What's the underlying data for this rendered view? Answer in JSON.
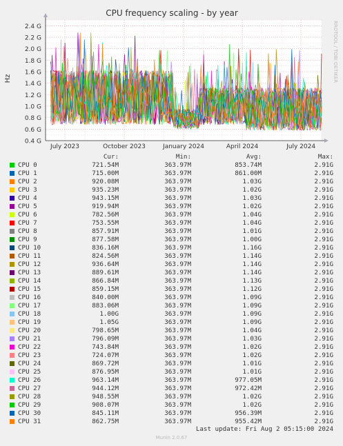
{
  "chart_data": {
    "type": "line",
    "title": "CPU frequency scaling - by year",
    "ylabel": "Hz",
    "side_label": "RRDTOOL / TOBI OETIKER",
    "ylim": [
      0.4,
      2.5
    ],
    "yticks": [
      {
        "v": 0.4,
        "label": "0.4 G"
      },
      {
        "v": 0.6,
        "label": "0.6 G"
      },
      {
        "v": 0.8,
        "label": "0.8 G"
      },
      {
        "v": 1.0,
        "label": "1.0 G"
      },
      {
        "v": 1.2,
        "label": "1.2 G"
      },
      {
        "v": 1.4,
        "label": "1.4 G"
      },
      {
        "v": 1.6,
        "label": "1.6 G"
      },
      {
        "v": 1.8,
        "label": "1.8 G"
      },
      {
        "v": 2.0,
        "label": "2.0 G"
      },
      {
        "v": 2.2,
        "label": "2.2 G"
      },
      {
        "v": 2.4,
        "label": "2.4 G"
      }
    ],
    "xlim": [
      "2023-06-01",
      "2024-08-02"
    ],
    "xticks": [
      {
        "date": "2023-07-01",
        "label": "July 2023"
      },
      {
        "date": "2023-10-01",
        "label": "October 2023"
      },
      {
        "date": "2024-01-01",
        "label": "January 2024"
      },
      {
        "date": "2024-04-01",
        "label": "April 2024"
      },
      {
        "date": "2024-07-01",
        "label": "July 2024"
      }
    ],
    "grid": true,
    "legend_headers": {
      "cur": "Cur:",
      "min": "Min:",
      "avg": "Avg:",
      "max": "Max:"
    },
    "series": [
      {
        "name": "CPU 0",
        "color": "#00cc00",
        "cur": "721.54M",
        "min": "363.97M",
        "avg": "853.74M",
        "max": "2.91G"
      },
      {
        "name": "CPU 1",
        "color": "#0066b3",
        "cur": "715.00M",
        "min": "363.97M",
        "avg": "861.00M",
        "max": "2.91G"
      },
      {
        "name": "CPU 2",
        "color": "#ff8000",
        "cur": "920.08M",
        "min": "363.97M",
        "avg": "1.03G",
        "max": "2.91G"
      },
      {
        "name": "CPU 3",
        "color": "#ffcc00",
        "cur": "935.23M",
        "min": "363.97M",
        "avg": "1.02G",
        "max": "2.91G"
      },
      {
        "name": "CPU 4",
        "color": "#330099",
        "cur": "943.15M",
        "min": "363.97M",
        "avg": "1.03G",
        "max": "2.91G"
      },
      {
        "name": "CPU 5",
        "color": "#990099",
        "cur": "919.94M",
        "min": "363.97M",
        "avg": "1.02G",
        "max": "2.91G"
      },
      {
        "name": "CPU 6",
        "color": "#ccff00",
        "cur": "782.56M",
        "min": "363.97M",
        "avg": "1.04G",
        "max": "2.91G"
      },
      {
        "name": "CPU 7",
        "color": "#ff0000",
        "cur": "753.55M",
        "min": "363.97M",
        "avg": "1.04G",
        "max": "2.91G"
      },
      {
        "name": "CPU 8",
        "color": "#808080",
        "cur": "857.91M",
        "min": "363.97M",
        "avg": "1.01G",
        "max": "2.91G"
      },
      {
        "name": "CPU 9",
        "color": "#008f00",
        "cur": "877.58M",
        "min": "363.97M",
        "avg": "1.00G",
        "max": "2.91G"
      },
      {
        "name": "CPU 10",
        "color": "#00487d",
        "cur": "836.16M",
        "min": "363.97M",
        "avg": "1.16G",
        "max": "2.91G"
      },
      {
        "name": "CPU 11",
        "color": "#b35a00",
        "cur": "824.56M",
        "min": "363.97M",
        "avg": "1.14G",
        "max": "2.91G"
      },
      {
        "name": "CPU 12",
        "color": "#b38f00",
        "cur": "936.64M",
        "min": "363.97M",
        "avg": "1.14G",
        "max": "2.91G"
      },
      {
        "name": "CPU 13",
        "color": "#6b006b",
        "cur": "889.61M",
        "min": "363.97M",
        "avg": "1.14G",
        "max": "2.91G"
      },
      {
        "name": "CPU 14",
        "color": "#8fb300",
        "cur": "866.84M",
        "min": "363.97M",
        "avg": "1.13G",
        "max": "2.91G"
      },
      {
        "name": "CPU 15",
        "color": "#b30000",
        "cur": "859.15M",
        "min": "363.97M",
        "avg": "1.12G",
        "max": "2.91G"
      },
      {
        "name": "CPU 16",
        "color": "#bebebe",
        "cur": "840.00M",
        "min": "363.97M",
        "avg": "1.09G",
        "max": "2.91G"
      },
      {
        "name": "CPU 17",
        "color": "#80ff80",
        "cur": "883.06M",
        "min": "363.97M",
        "avg": "1.09G",
        "max": "2.91G"
      },
      {
        "name": "CPU 18",
        "color": "#80c9ff",
        "cur": "1.00G",
        "min": "363.97M",
        "avg": "1.09G",
        "max": "2.91G"
      },
      {
        "name": "CPU 19",
        "color": "#ffc080",
        "cur": "1.05G",
        "min": "363.97M",
        "avg": "1.09G",
        "max": "2.91G"
      },
      {
        "name": "CPU 20",
        "color": "#ffe680",
        "cur": "798.65M",
        "min": "363.97M",
        "avg": "1.04G",
        "max": "2.91G"
      },
      {
        "name": "CPU 21",
        "color": "#aa80ff",
        "cur": "796.09M",
        "min": "363.97M",
        "avg": "1.03G",
        "max": "2.91G"
      },
      {
        "name": "CPU 22",
        "color": "#ee00cc",
        "cur": "743.84M",
        "min": "363.97M",
        "avg": "1.02G",
        "max": "2.91G"
      },
      {
        "name": "CPU 23",
        "color": "#ff8080",
        "cur": "724.07M",
        "min": "363.97M",
        "avg": "1.02G",
        "max": "2.91G"
      },
      {
        "name": "CPU 24",
        "color": "#666600",
        "cur": "869.72M",
        "min": "363.97M",
        "avg": "1.01G",
        "max": "2.91G"
      },
      {
        "name": "CPU 25",
        "color": "#ffbfff",
        "cur": "876.95M",
        "min": "363.97M",
        "avg": "1.01G",
        "max": "2.91G"
      },
      {
        "name": "CPU 26",
        "color": "#00ffcc",
        "cur": "963.14M",
        "min": "363.97M",
        "avg": "977.05M",
        "max": "2.91G"
      },
      {
        "name": "CPU 27",
        "color": "#cc6699",
        "cur": "944.12M",
        "min": "363.97M",
        "avg": "972.42M",
        "max": "2.91G"
      },
      {
        "name": "CPU 28",
        "color": "#999900",
        "cur": "948.55M",
        "min": "363.97M",
        "avg": "1.02G",
        "max": "2.91G"
      },
      {
        "name": "CPU 29",
        "color": "#00cc00",
        "cur": "908.07M",
        "min": "363.97M",
        "avg": "1.02G",
        "max": "2.91G"
      },
      {
        "name": "CPU 30",
        "color": "#0066b3",
        "cur": "845.11M",
        "min": "363.97M",
        "avg": "956.39M",
        "max": "2.91G"
      },
      {
        "name": "CPU 31",
        "color": "#ff8000",
        "cur": "862.75M",
        "min": "363.97M",
        "avg": "955.42M",
        "max": "2.91G"
      }
    ],
    "last_update": "Last update: Fri Aug  2 05:15:00 2024",
    "footer": "Munin 2.0.67"
  }
}
